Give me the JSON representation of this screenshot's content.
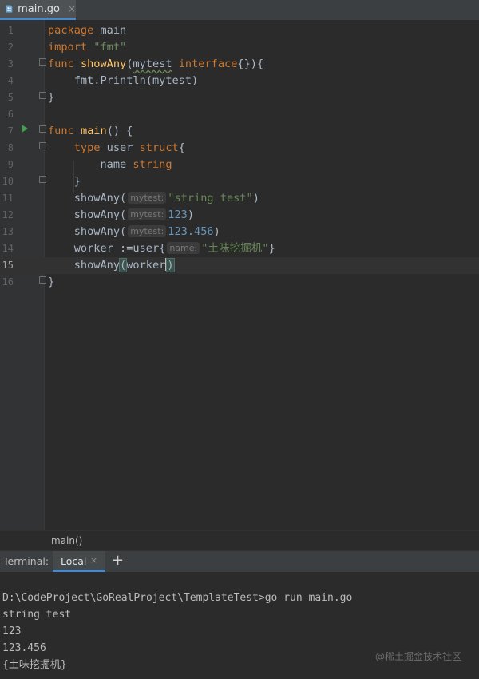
{
  "tab": {
    "filename": "main.go",
    "close": "×"
  },
  "editor": {
    "lines": [
      {
        "n": "1",
        "tokens": [
          {
            "t": "package",
            "c": "kw"
          },
          {
            "t": " main",
            "c": "pkg"
          }
        ]
      },
      {
        "n": "2",
        "tokens": [
          {
            "t": "import",
            "c": "kw"
          },
          {
            "t": " \"fmt\"",
            "c": "str"
          }
        ]
      },
      {
        "n": "3",
        "tokens": [
          {
            "t": "func",
            "c": "kw"
          },
          {
            "t": " ",
            "c": ""
          },
          {
            "t": "showAny",
            "c": "fn"
          },
          {
            "t": "(",
            "c": ""
          },
          {
            "t": "mytest",
            "c": "wavy"
          },
          {
            "t": " ",
            "c": ""
          },
          {
            "t": "interface",
            "c": "kw"
          },
          {
            "t": "{}){",
            "c": ""
          }
        ]
      },
      {
        "n": "4",
        "tokens": [
          {
            "t": "    fmt.Println(mytest)",
            "c": ""
          }
        ]
      },
      {
        "n": "5",
        "tokens": [
          {
            "t": "}",
            "c": ""
          }
        ]
      },
      {
        "n": "6",
        "tokens": []
      },
      {
        "n": "7",
        "tokens": [
          {
            "t": "func",
            "c": "kw"
          },
          {
            "t": " ",
            "c": ""
          },
          {
            "t": "main",
            "c": "fn"
          },
          {
            "t": "() {",
            "c": ""
          }
        ]
      },
      {
        "n": "8",
        "tokens": [
          {
            "t": "    ",
            "c": ""
          },
          {
            "t": "type",
            "c": "kw"
          },
          {
            "t": " user ",
            "c": "ty"
          },
          {
            "t": "struct",
            "c": "kw"
          },
          {
            "t": "{",
            "c": ""
          }
        ]
      },
      {
        "n": "9",
        "tokens": [
          {
            "t": "        name ",
            "c": ""
          },
          {
            "t": "string",
            "c": "kw"
          }
        ]
      },
      {
        "n": "10",
        "tokens": [
          {
            "t": "    }",
            "c": ""
          }
        ]
      },
      {
        "n": "11",
        "tokens": [
          {
            "t": "    showAny(",
            "c": ""
          },
          {
            "t": "mytest:",
            "c": "hint"
          },
          {
            "t": "\"string test\"",
            "c": "str"
          },
          {
            "t": ")",
            "c": ""
          }
        ]
      },
      {
        "n": "12",
        "tokens": [
          {
            "t": "    showAny(",
            "c": ""
          },
          {
            "t": "mytest:",
            "c": "hint"
          },
          {
            "t": "123",
            "c": "num"
          },
          {
            "t": ")",
            "c": ""
          }
        ]
      },
      {
        "n": "13",
        "tokens": [
          {
            "t": "    showAny(",
            "c": ""
          },
          {
            "t": "mytest:",
            "c": "hint"
          },
          {
            "t": "123.456",
            "c": "num"
          },
          {
            "t": ")",
            "c": ""
          }
        ]
      },
      {
        "n": "14",
        "tokens": [
          {
            "t": "    worker :=user{",
            "c": ""
          },
          {
            "t": "name:",
            "c": "hint"
          },
          {
            "t": "\"土味挖掘机\"",
            "c": "str"
          },
          {
            "t": "}",
            "c": ""
          }
        ]
      },
      {
        "n": "15",
        "tokens": [
          {
            "t": "    showAny",
            "c": ""
          },
          {
            "t": "(",
            "c": "brace-match"
          },
          {
            "t": "worker",
            "c": ""
          },
          {
            "t": "",
            "c": "caret"
          },
          {
            "t": ")",
            "c": "brace-match"
          }
        ]
      },
      {
        "n": "16",
        "tokens": [
          {
            "t": "}",
            "c": ""
          }
        ]
      }
    ],
    "current_line": "15"
  },
  "breadcrumb": {
    "label": "main()"
  },
  "terminal": {
    "label": "Terminal:",
    "tab": "Local",
    "tab_close": "×",
    "add": "+",
    "lines": [
      "D:\\CodeProject\\GoRealProject\\TemplateTest>go run main.go",
      "string test",
      "123",
      "123.456",
      "{土味挖掘机}"
    ]
  },
  "watermark": "@稀土掘金技术社区",
  "colors": {
    "keyword": "#cc7832",
    "string": "#6a8759",
    "number": "#6897bb",
    "function": "#ffc66d",
    "text": "#a9b7c6",
    "accent": "#4a88c7",
    "run": "#499c54"
  }
}
